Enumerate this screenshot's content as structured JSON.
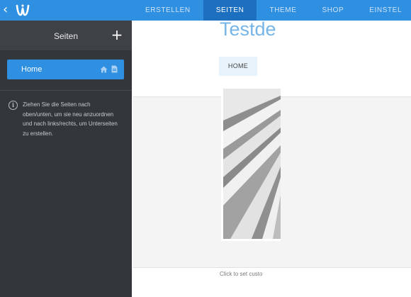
{
  "topbar": {
    "nav": [
      {
        "label": "Erstellen",
        "active": false
      },
      {
        "label": "Seiten",
        "active": true
      },
      {
        "label": "Theme",
        "active": false
      },
      {
        "label": "Shop",
        "active": false
      },
      {
        "label": "Einstel",
        "active": false
      }
    ],
    "icons": {
      "back": "chevron-left-icon",
      "logo": "weebly-logo-icon"
    },
    "colors": {
      "bar": "#2f8fe0",
      "active": "#1d6fc0"
    }
  },
  "sidebar": {
    "title": "Seiten",
    "add_icon": "plus-icon",
    "pages": [
      {
        "label": "Home",
        "icons": [
          "home-icon",
          "document-icon"
        ]
      }
    ],
    "info_text": "Ziehen Sie die Seiten nach oben/unten, um sie neu anzuordnen und nach links/rechts, um Unterseiten zu erstellen."
  },
  "annotation": {
    "icon": "arrow-left-icon",
    "color": "#e06a3c"
  },
  "site_preview": {
    "title": "Testde",
    "nav": [
      "HOME"
    ],
    "image": "abstract-architecture-image",
    "footer_text": "Click to set custo"
  }
}
